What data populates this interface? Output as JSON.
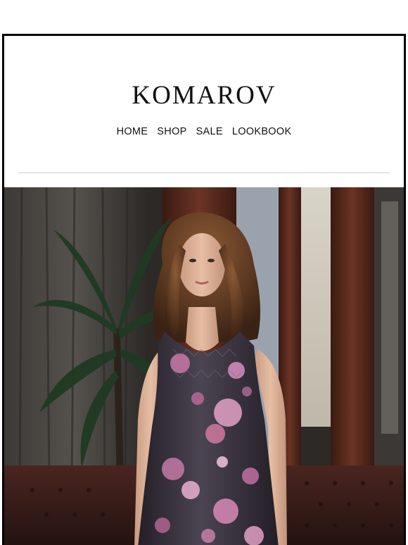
{
  "brand": {
    "name": "KOMAROV"
  },
  "nav": {
    "items": [
      {
        "label": "HOME"
      },
      {
        "label": "SHOP"
      },
      {
        "label": "SALE"
      },
      {
        "label": "LOOKBOOK"
      }
    ]
  },
  "hero": {
    "image": "model-in-floral-satin-dress",
    "colors": {
      "dress_dark": "#2b2730",
      "floral_pink": "#d88ab8",
      "wood": "#5a2e22",
      "leather": "#3a1e1a"
    }
  }
}
